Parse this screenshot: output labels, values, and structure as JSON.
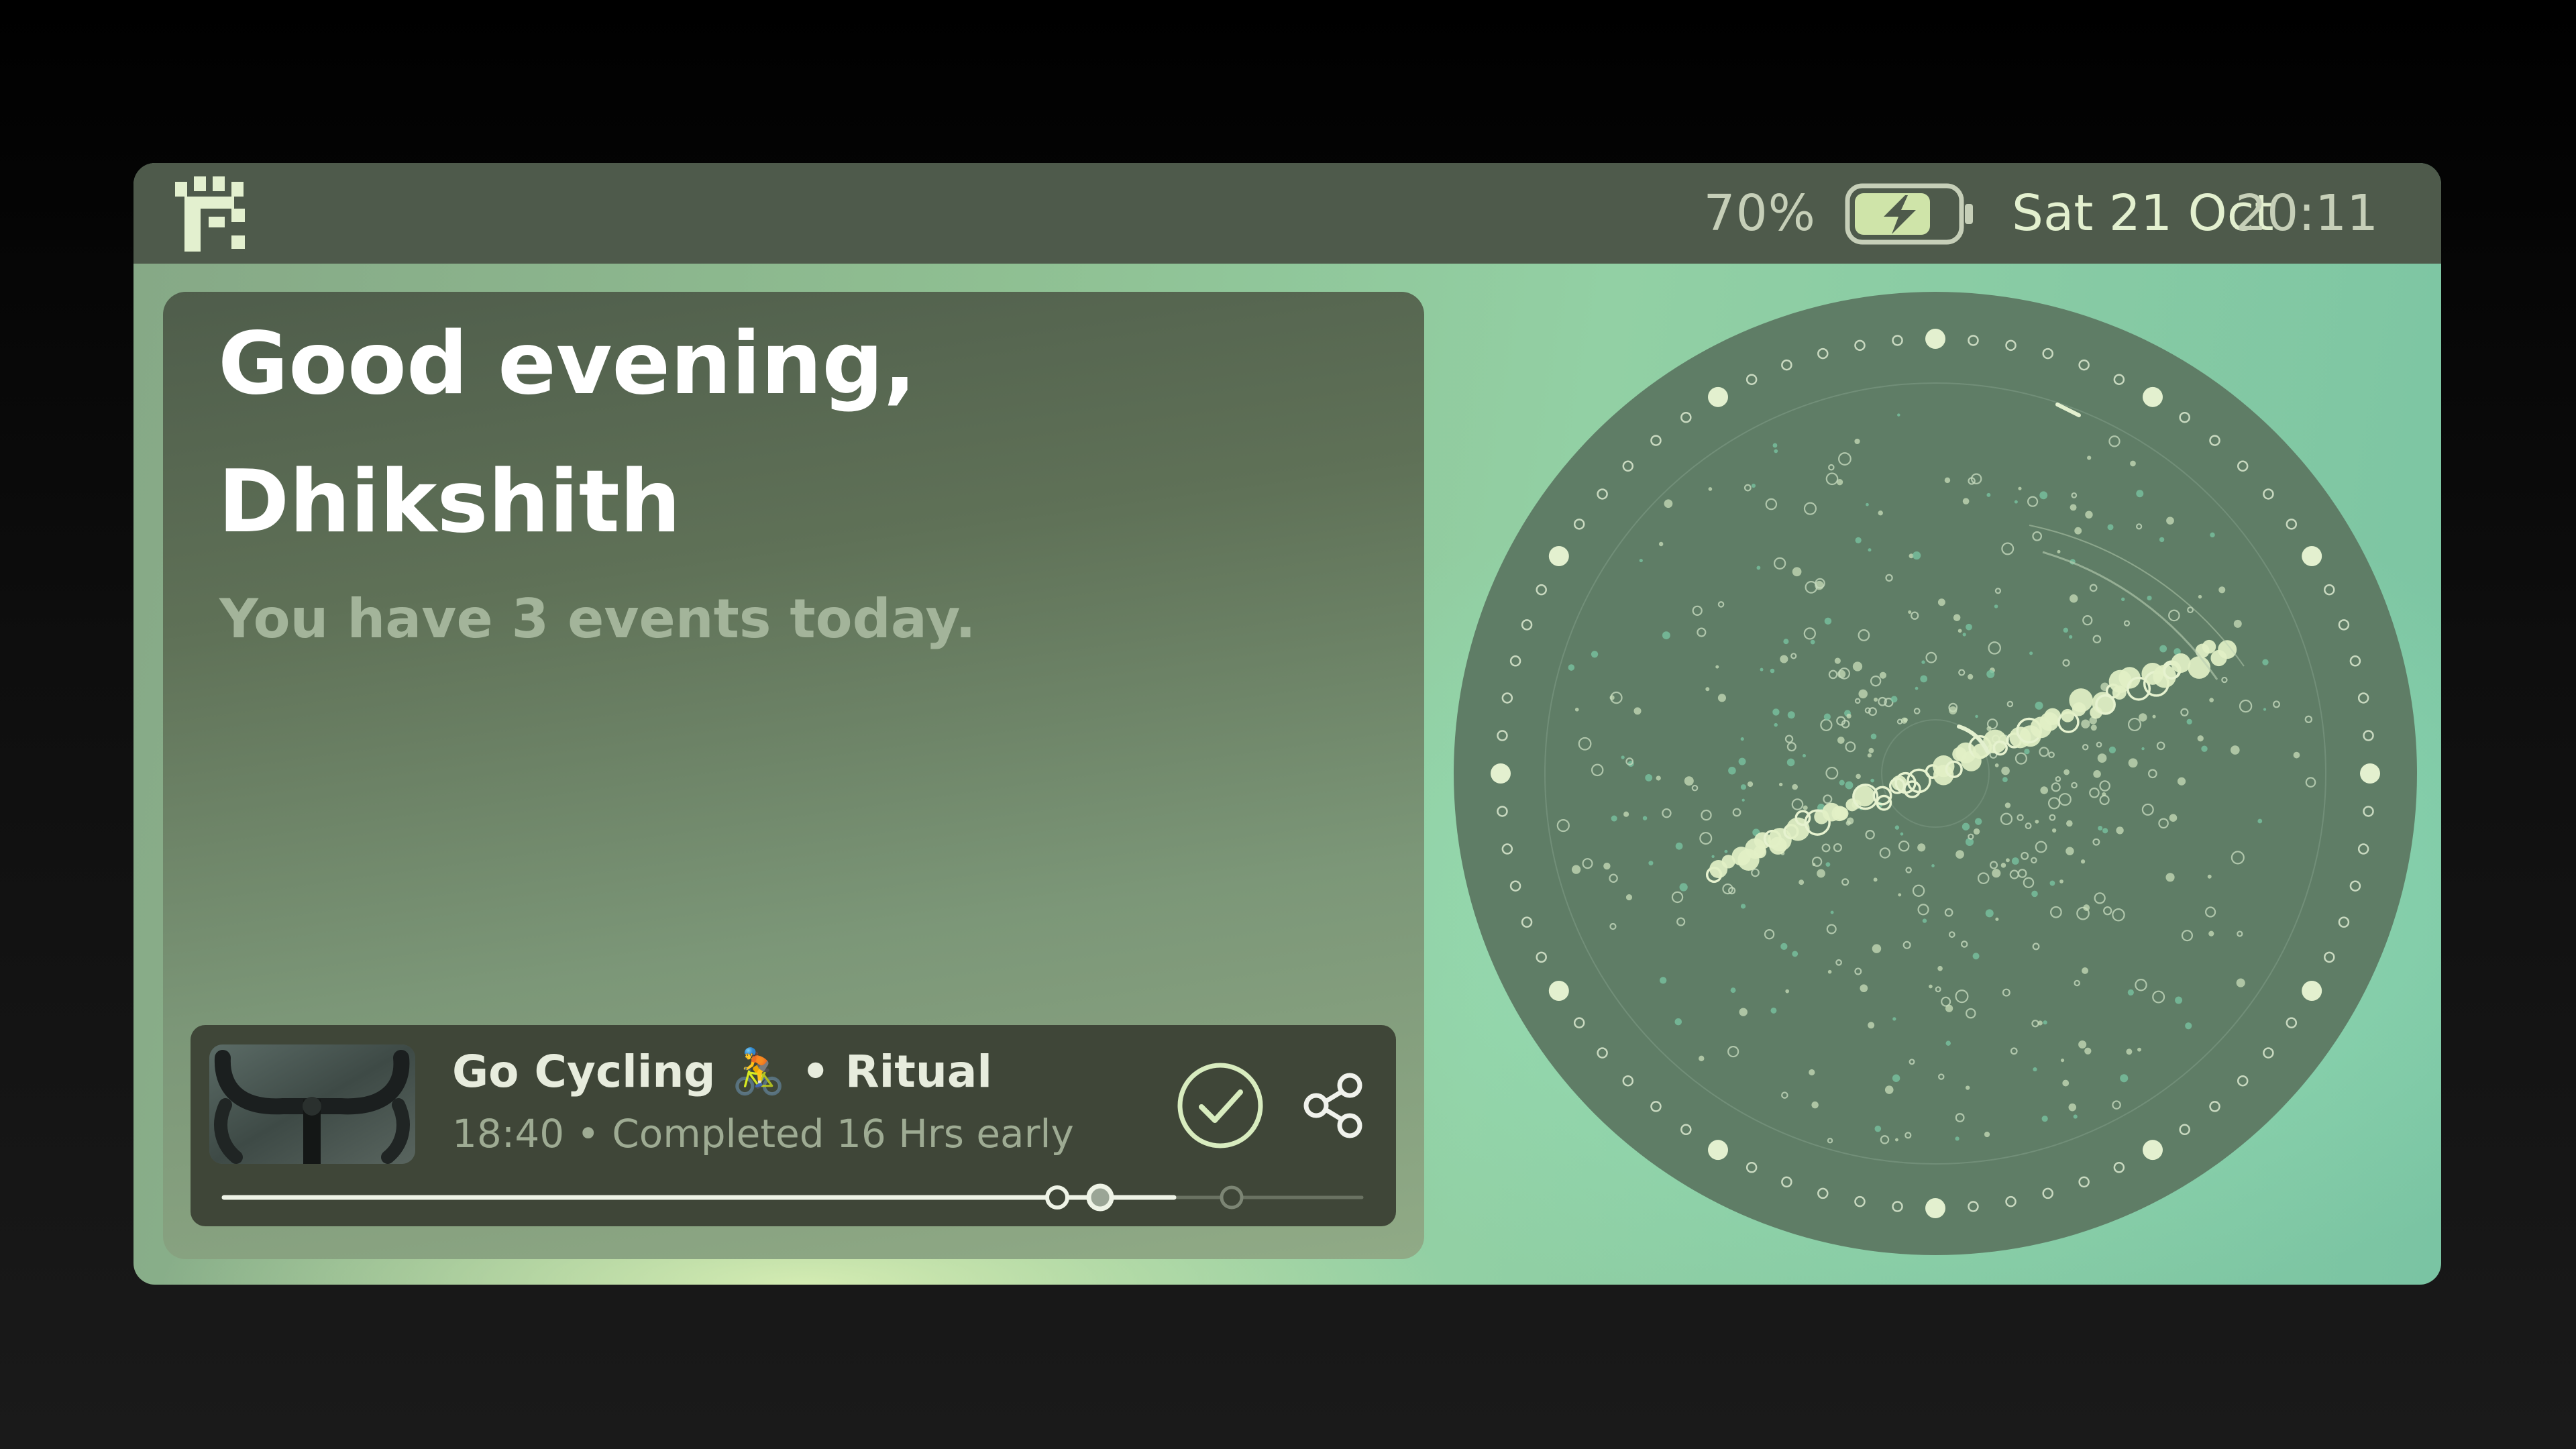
{
  "status_bar": {
    "battery_percent": "70%",
    "date": "Sat 21 Oct",
    "time": "20:11",
    "battery_level": 0.7,
    "charging": true
  },
  "greeting": {
    "line1": "Good evening,",
    "line2": "Dhikshith",
    "subtitle": "You have 3 events today."
  },
  "event_card": {
    "title": "Go Cycling 🚴 • Ritual",
    "meta": "18:40 • Completed 16 Hrs early",
    "thumbnail_icon": "bicycle-handlebar-photo",
    "complete_icon": "check-circle-icon",
    "share_icon": "share-icon",
    "progress_fraction": 0.77
  },
  "colors": {
    "accent": "#e3f0cf",
    "dial_fill": "#5e7c65",
    "card_bg": "#3f4638",
    "status_bar_bg": "#4e5a4b"
  }
}
